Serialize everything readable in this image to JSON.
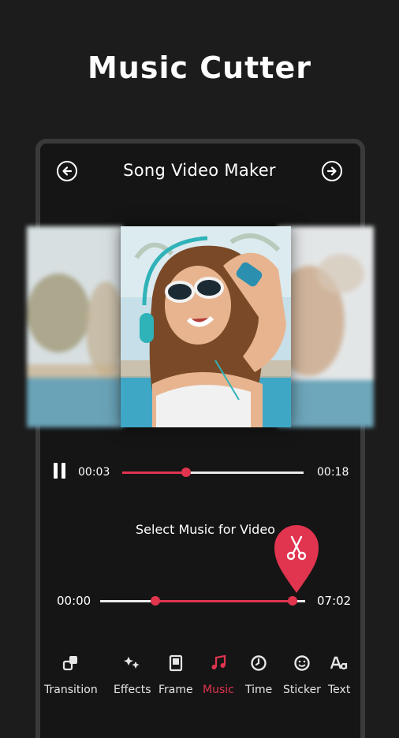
{
  "headline": "Music Cutter",
  "header": {
    "title": "Song Video Maker",
    "back_icon": "arrow-left-circle-icon",
    "forward_icon": "arrow-right-circle-icon"
  },
  "player": {
    "current_time": "00:03",
    "total_time": "00:18",
    "progress": 0.35
  },
  "music": {
    "label": "Select Music for Video",
    "start_time": "00:00",
    "end_time": "07:02",
    "range_start": 0.27,
    "range_end": 0.94,
    "cut_icon": "scissors-icon"
  },
  "toolbar": {
    "items": [
      {
        "label": "Transition",
        "icon": "transition-icon"
      },
      {
        "label": "Effects",
        "icon": "effects-icon"
      },
      {
        "label": "Frame",
        "icon": "frame-icon"
      },
      {
        "label": "Music",
        "icon": "music-note-icon",
        "active": true
      },
      {
        "label": "Time",
        "icon": "clock-icon"
      },
      {
        "label": "Sticker",
        "icon": "sticker-icon"
      },
      {
        "label": "Text",
        "icon": "text-icon"
      }
    ]
  },
  "colors": {
    "accent": "#e0344f",
    "background": "#1c1c1c"
  }
}
